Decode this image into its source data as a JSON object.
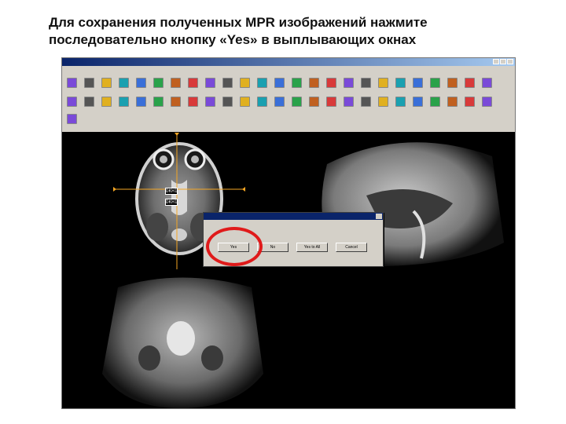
{
  "heading": {
    "line1": "Для сохранения полученных MPR изображений нажмите",
    "line2": "последовательно кнопку «Yes» в выплывающих окнах"
  },
  "colors": {
    "highlight_ring": "#e01a1a",
    "title_bar": "#0a246a",
    "crosshair": "#f5a623"
  },
  "dialog": {
    "button_labels": [
      "Yes",
      "No",
      "Yes to All",
      "Cancel"
    ]
  },
  "viewer": {
    "crosshair_labels": [
      "DKH1",
      "DKH1"
    ]
  },
  "icons": [
    "toolbar-tool-icon",
    "crosshair-icon",
    "mpr-icon",
    "scissors-icon"
  ]
}
